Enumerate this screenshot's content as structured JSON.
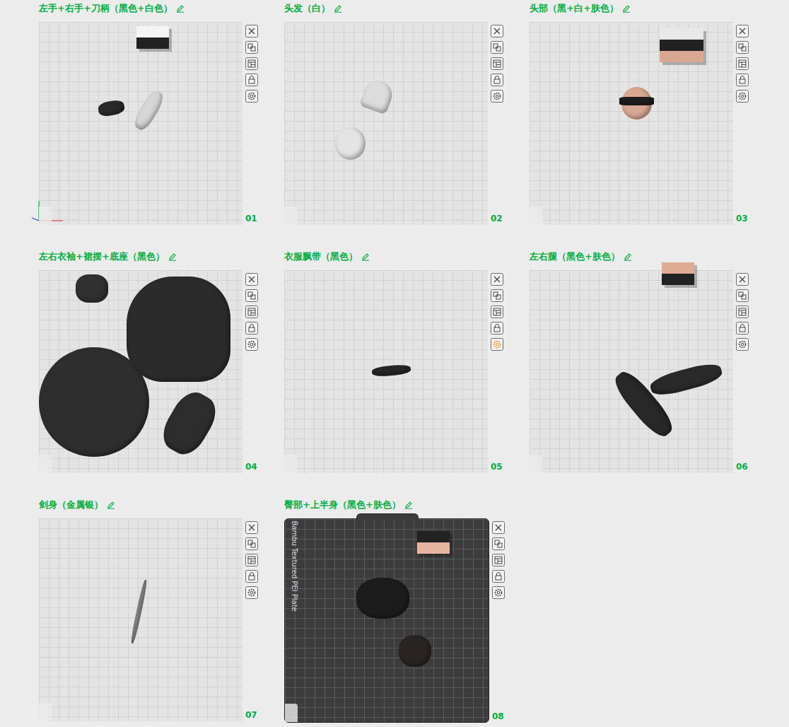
{
  "plates": [
    {
      "number": "01",
      "title": "左手+右手+刀柄（黑色+白色）",
      "plate_type": "smooth",
      "plate_label": "",
      "settings_highlighted": false,
      "show_axes": true,
      "filaments": [
        {
          "color": "#f4f4f4"
        },
        {
          "color": "#222222"
        }
      ],
      "objects": [
        {
          "color": "#2a2a2a"
        },
        {
          "color": "#d6d6d6"
        }
      ]
    },
    {
      "number": "02",
      "title": "头发（白）",
      "plate_type": "smooth",
      "plate_label": "",
      "settings_highlighted": false,
      "show_axes": false,
      "filaments": [],
      "objects": [
        {
          "color": "#dcdcdc"
        },
        {
          "color": "#e4e4e4"
        }
      ]
    },
    {
      "number": "03",
      "title": "头部（黑+白+肤色）",
      "plate_type": "smooth",
      "plate_label": "",
      "settings_highlighted": false,
      "show_axes": false,
      "filaments": [
        {
          "color": "#e8e8e8"
        },
        {
          "color": "#222222"
        },
        {
          "color": "#d9a893"
        }
      ],
      "objects": [
        {
          "color": "#d9a893"
        },
        {
          "color": "#1e1e1e"
        }
      ]
    },
    {
      "number": "04",
      "title": "左右衣袖+裙摆+底座（黑色）",
      "plate_type": "smooth",
      "plate_label": "",
      "settings_highlighted": false,
      "show_axes": false,
      "filaments": [],
      "objects": [
        {
          "color": "#2e2e2e"
        },
        {
          "color": "#2b2b2b"
        },
        {
          "color": "#303030"
        },
        {
          "color": "#2d2d2d"
        }
      ]
    },
    {
      "number": "05",
      "title": "衣服飘带（黑色）",
      "plate_type": "smooth",
      "plate_label": "",
      "settings_highlighted": true,
      "show_axes": false,
      "filaments": [],
      "objects": [
        {
          "color": "#262626"
        }
      ]
    },
    {
      "number": "06",
      "title": "左右腿（黑色+肤色）",
      "plate_type": "smooth",
      "plate_label": "",
      "settings_highlighted": false,
      "show_axes": false,
      "filaments": [
        {
          "color": "#e0ab95"
        },
        {
          "color": "#222222"
        }
      ],
      "objects": [
        {
          "color": "#282828"
        },
        {
          "color": "#2a2a2a"
        }
      ]
    },
    {
      "number": "07",
      "title": "剑身（金属银）",
      "plate_type": "smooth",
      "plate_label": "",
      "settings_highlighted": false,
      "show_axes": false,
      "filaments": [],
      "objects": [
        {
          "color": "#8e8e8e"
        }
      ]
    },
    {
      "number": "08",
      "title": "臀部+上半身（黑色+肤色）",
      "plate_type": "textured",
      "plate_label": "Bambu Textured PEI Plate",
      "settings_highlighted": false,
      "show_axes": false,
      "filaments": [
        {
          "color": "#222222"
        },
        {
          "color": "#e6b4a0"
        }
      ],
      "objects": [
        {
          "color": "#1c1c1c"
        },
        {
          "color": "#2a2422"
        }
      ]
    }
  ]
}
